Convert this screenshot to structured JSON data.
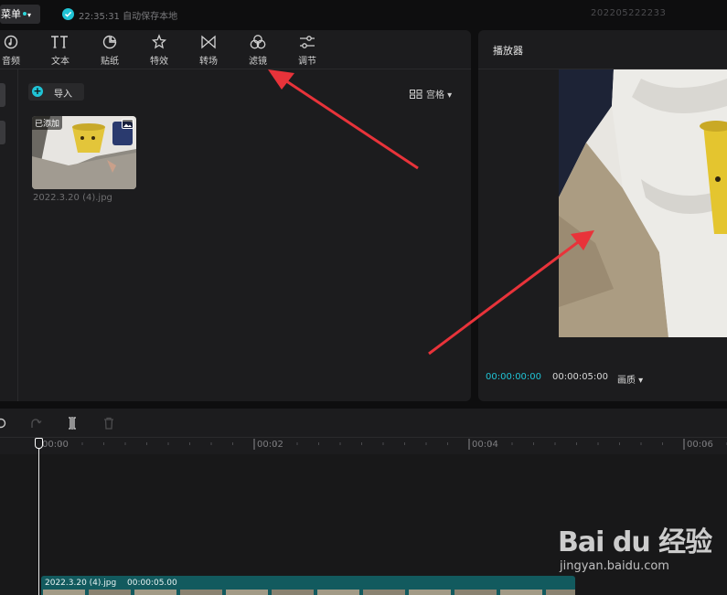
{
  "topbar": {
    "menu_label": "菜单",
    "autosave_text": "22:35:31 自动保存本地",
    "project_name": "202205222233"
  },
  "toolbar": {
    "items": [
      {
        "label": "音频",
        "icon": "audio-icon"
      },
      {
        "label": "文本",
        "icon": "text-icon"
      },
      {
        "label": "贴纸",
        "icon": "sticker-icon"
      },
      {
        "label": "特效",
        "icon": "effects-icon"
      },
      {
        "label": "转场",
        "icon": "transition-icon"
      },
      {
        "label": "滤镜",
        "icon": "filter-icon"
      },
      {
        "label": "调节",
        "icon": "adjust-icon"
      }
    ]
  },
  "media": {
    "import_label": "导入",
    "view_label": "宫格",
    "thumbnail_badge": "已添加",
    "file_name": "2022.3.20 (4).jpg"
  },
  "player": {
    "title": "播放器",
    "current_time": "00:00:00:00",
    "total_time": "00:00:05:00",
    "quality_label": "画质"
  },
  "timeline": {
    "ruler_labels": [
      "00:00",
      "00:02",
      "00:04",
      "00:06"
    ],
    "clip_name": "2022.3.20 (4).jpg",
    "clip_duration": "00:00:05.00"
  },
  "watermark": {
    "brand": "Bai du 经验",
    "url": "jingyan.baidu.com"
  },
  "colors": {
    "accent": "#20c4d6",
    "annotation_arrow": "#e8333a",
    "clip": "#125a5e"
  }
}
